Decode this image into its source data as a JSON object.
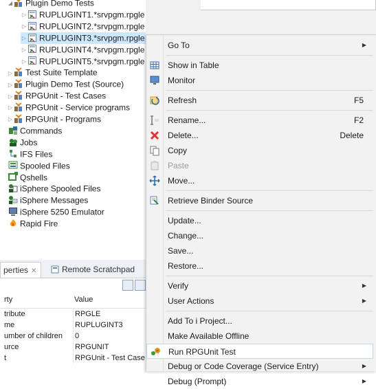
{
  "tree": {
    "items": [
      {
        "label": "Plugin Demo Tests",
        "icon": "test-folder-icon",
        "twisty": "◢",
        "indent": 0
      },
      {
        "label": "RUPLUGINT1.*srvpgm.rpgle",
        "icon": "source-member-icon",
        "twisty": "▷",
        "indent": 1
      },
      {
        "label": "RUPLUGINT2.*srvpgm.rpgle",
        "icon": "source-member-icon",
        "twisty": "▷",
        "indent": 1
      },
      {
        "label": "RUPLUGINT3.*srvpgm.rpgle",
        "icon": "source-member-icon",
        "twisty": "▷",
        "indent": 1,
        "selected": true
      },
      {
        "label": "RUPLUGINT4.*srvpgm.rpgle",
        "icon": "source-member-icon",
        "twisty": "▷",
        "indent": 1
      },
      {
        "label": "RUPLUGINT5.*srvpgm.rpgle",
        "icon": "source-member-icon",
        "twisty": "▷",
        "indent": 1
      },
      {
        "label": "Test Suite Template",
        "icon": "test-folder-icon",
        "twisty": "▷",
        "indent": 0
      },
      {
        "label": "Plugin Demo Test (Source)",
        "icon": "test-folder-icon",
        "twisty": "▷",
        "indent": 0
      },
      {
        "label": "RPGUnit - Test Cases",
        "icon": "test-folder-icon",
        "twisty": "▷",
        "indent": 0
      },
      {
        "label": "RPGUnit - Service programs",
        "icon": "test-folder-icon",
        "twisty": "▷",
        "indent": 0
      },
      {
        "label": "RPGUnit - Programs",
        "icon": "test-folder-icon",
        "twisty": "▷",
        "indent": 0
      },
      {
        "label": "Commands",
        "icon": "commands-icon",
        "twisty": "",
        "indent": -1
      },
      {
        "label": "Jobs",
        "icon": "jobs-icon",
        "twisty": "",
        "indent": -1
      },
      {
        "label": "IFS Files",
        "icon": "ifs-files-icon",
        "twisty": "",
        "indent": -1
      },
      {
        "label": "Spooled Files",
        "icon": "spooled-files-icon",
        "twisty": "",
        "indent": -1
      },
      {
        "label": "Qshells",
        "icon": "qshells-icon",
        "twisty": "",
        "indent": -1
      },
      {
        "label": "iSphere Spooled Files",
        "icon": "isphere-spooled-icon",
        "twisty": "",
        "indent": -1
      },
      {
        "label": "iSphere Messages",
        "icon": "isphere-messages-icon",
        "twisty": "",
        "indent": -1
      },
      {
        "label": "iSphere 5250 Emulator",
        "icon": "emulator-icon",
        "twisty": "",
        "indent": -1
      },
      {
        "label": "Rapid Fire",
        "icon": "rapid-fire-icon",
        "twisty": "",
        "indent": -1
      }
    ]
  },
  "properties": {
    "tabs": [
      {
        "label": "perties",
        "close": "✕"
      },
      {
        "label": "Remote Scratchpad"
      }
    ],
    "headers": {
      "property": "rty",
      "value": "Value"
    },
    "rows": [
      {
        "property": "tribute",
        "value": "RPGLE"
      },
      {
        "property": "me",
        "value": "RUPLUGINT3"
      },
      {
        "property": "umber of children",
        "value": "0"
      },
      {
        "property": "urce",
        "value": "RPGUNIT"
      },
      {
        "property": "t",
        "value": "RPGUnit - Test Case"
      }
    ]
  },
  "menu": {
    "items": [
      {
        "label": "Go To",
        "submenu": true,
        "icon": ""
      },
      {
        "sep": true
      },
      {
        "label": "Show in Table",
        "icon": "table-icon"
      },
      {
        "label": "Monitor",
        "icon": "monitor-icon"
      },
      {
        "sep": true
      },
      {
        "label": "Refresh",
        "shortcut": "F5",
        "icon": "refresh-icon"
      },
      {
        "sep": true
      },
      {
        "label": "Rename...",
        "shortcut": "F2",
        "icon": "rename-icon"
      },
      {
        "label": "Delete...",
        "shortcut": "Delete",
        "icon": "delete-icon"
      },
      {
        "label": "Copy",
        "icon": "copy-icon"
      },
      {
        "label": "Paste",
        "icon": "paste-icon",
        "disabled": true
      },
      {
        "label": "Move...",
        "icon": "move-icon"
      },
      {
        "sep": true
      },
      {
        "label": "Retrieve Binder Source",
        "icon": "binder-source-icon"
      },
      {
        "sep": true
      },
      {
        "label": "Update...",
        "icon": ""
      },
      {
        "label": "Change...",
        "icon": ""
      },
      {
        "label": "Save...",
        "icon": ""
      },
      {
        "label": "Restore...",
        "icon": ""
      },
      {
        "sep": true
      },
      {
        "label": "Verify",
        "submenu": true,
        "icon": ""
      },
      {
        "label": "User Actions",
        "submenu": true,
        "icon": ""
      },
      {
        "sep": true
      },
      {
        "label": "Add To i Project...",
        "icon": ""
      },
      {
        "label": "Make Available Offline",
        "icon": ""
      },
      {
        "label": "Run RPGUnit Test",
        "icon": "run-test-icon",
        "highlighted": true
      },
      {
        "label": "Debug or Code Coverage (Service Entry)",
        "submenu": true,
        "icon": ""
      },
      {
        "label": "Debug (Prompt)",
        "submenu": true,
        "icon": ""
      }
    ]
  }
}
